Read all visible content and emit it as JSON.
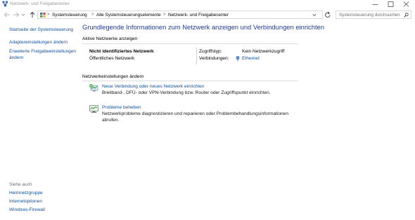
{
  "window": {
    "title": "Netzwerk- und Freigabecenter"
  },
  "address": {
    "crumbs": [
      "Systemsteuerung",
      "Alle Systemsteuerungselemente",
      "Netzwerk- und Freigabecenter"
    ],
    "search_placeholder": "Systemsteuerung durchsuchen"
  },
  "sidebar": {
    "links": [
      "Startseite der Systemsteuerung",
      "Adaptereinstellungen ändern",
      "Erweiterte Freigabeeinstellungen ändern"
    ],
    "see_also_label": "Siehe auch",
    "see_also": [
      "Heimnetzgruppe",
      "Internetoptionen",
      "Windows-Firewall"
    ]
  },
  "main": {
    "title": "Grundlegende Informationen zum Netzwerk anzeigen und Verbindungen einrichten",
    "active_networks_header": "Aktive Netzwerke anzeigen",
    "network": {
      "name": "Nicht identifiziertes Netzwerk",
      "category": "Öffentliches Netzwerk",
      "access_type_label": "Zugriffstyp:",
      "access_type_value": "Kein Netzwerkzugriff",
      "connections_label": "Verbindungen:",
      "connection_value": "Ethernet"
    },
    "change_settings_header": "Netzwerkeinstellungen ändern",
    "tasks": [
      {
        "link": "Neue Verbindung oder neues Netzwerk einrichten",
        "description": "Breitband-, DFÜ- oder VPN-Verbindung bzw. Router oder Zugriffspunkt einrichten.",
        "icon": "new-connection-icon"
      },
      {
        "link": "Probleme beheben",
        "description": "Netzwerkprobleme diagnostizieren und reparieren oder Problembehandlungsinformationen abrufen.",
        "icon": "troubleshoot-icon"
      }
    ]
  },
  "colors": {
    "link": "#0f4f9f",
    "title": "#1e3b94",
    "title_bar_text": "#9a9a9a"
  }
}
